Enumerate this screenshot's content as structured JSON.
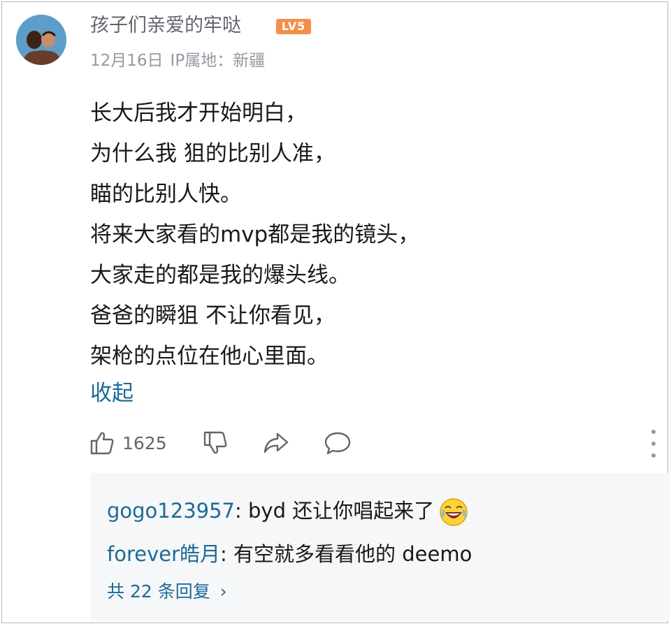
{
  "comment": {
    "username": "孩子们亲爱的牢哒",
    "level_badge": "LV5",
    "date": "12月16日",
    "ip_location": "IP属地：新疆",
    "body_lines": [
      "长大后我才开始明白，",
      "为什么我 狙的比别人准，",
      "瞄的比别人快。",
      "将来大家看的mvp都是我的镜头，",
      "大家走的都是我的爆头线。",
      "爸爸的瞬狙 不让你看见，",
      "架枪的点位在他心里面。"
    ],
    "collapse_label": "收起",
    "like_count": "1625"
  },
  "replies": {
    "items": [
      {
        "name": "gogo123957",
        "text": ": byd 还让你唱起来了"
      },
      {
        "name": "forever皓月",
        "text": ": 有空就多看看他的 deemo"
      }
    ],
    "more_label": "共 22 条回复",
    "more_chevron": "›"
  },
  "colors": {
    "link": "#1e6a96",
    "meta": "#9499a0",
    "badge": "#f58e4a",
    "reply_bg": "#f6f7f8"
  },
  "icons": [
    "avatar",
    "like-icon",
    "dislike-icon",
    "share-icon",
    "reply-icon",
    "more-icon",
    "laughing-crying-emoji"
  ]
}
